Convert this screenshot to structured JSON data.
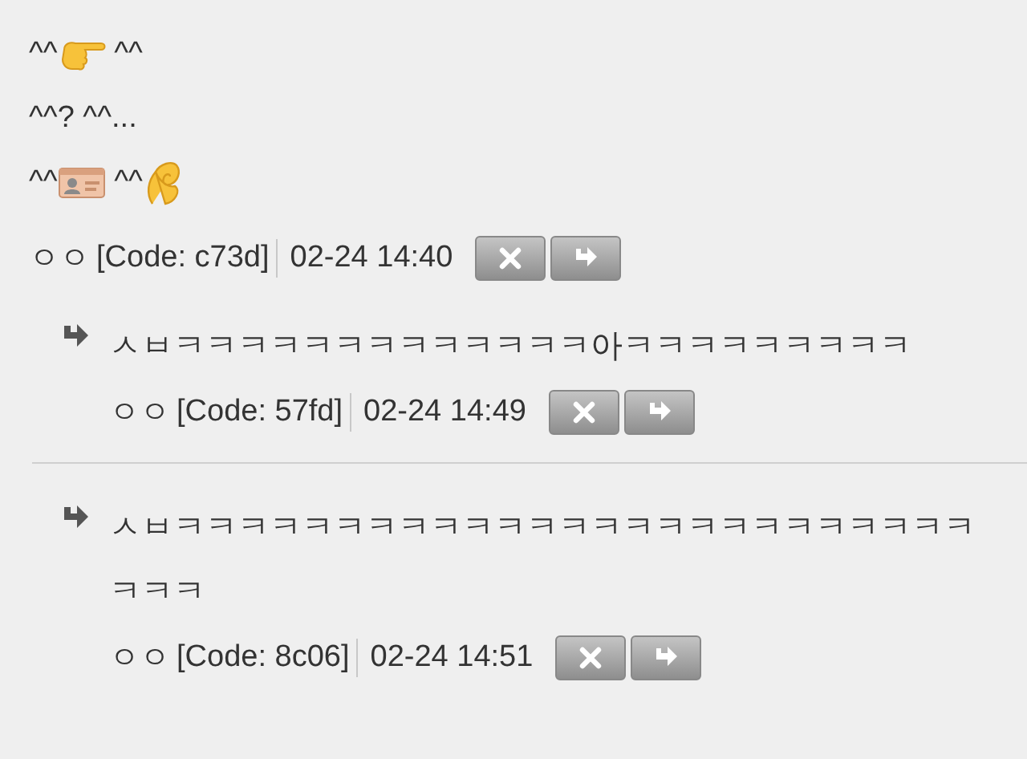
{
  "comment": {
    "lines": [
      [
        {
          "kind": "text",
          "text": "^^"
        },
        {
          "kind": "pointing-hand"
        },
        {
          "kind": "text",
          "text": " ^^"
        }
      ],
      [
        {
          "kind": "text",
          "text": "^^? ^^..."
        }
      ],
      [
        {
          "kind": "text",
          "text": "^^"
        },
        {
          "kind": "id-card"
        },
        {
          "kind": "text",
          "text": " ^^"
        },
        {
          "kind": "pinch"
        }
      ]
    ],
    "author": "ㅇㅇ",
    "code": "[Code: c73d]",
    "time": "02-24 14:40"
  },
  "replies": [
    {
      "text": "ㅅㅂㅋㅋㅋㅋㅋㅋㅋㅋㅋㅋㅋㅋㅋ아ㅋㅋㅋㅋㅋㅋㅋㅋㅋ",
      "author": "ㅇㅇ",
      "code": "[Code: 57fd]",
      "time": "02-24 14:49"
    },
    {
      "text": "ㅅㅂㅋㅋㅋㅋㅋㅋㅋㅋㅋㅋㅋㅋㅋㅋㅋㅋㅋㅋㅋㅋㅋㅋㅋㅋㅋㅋㅋㅋ",
      "author": "ㅇㅇ",
      "code": "[Code: 8c06]",
      "time": "02-24 14:51"
    }
  ]
}
